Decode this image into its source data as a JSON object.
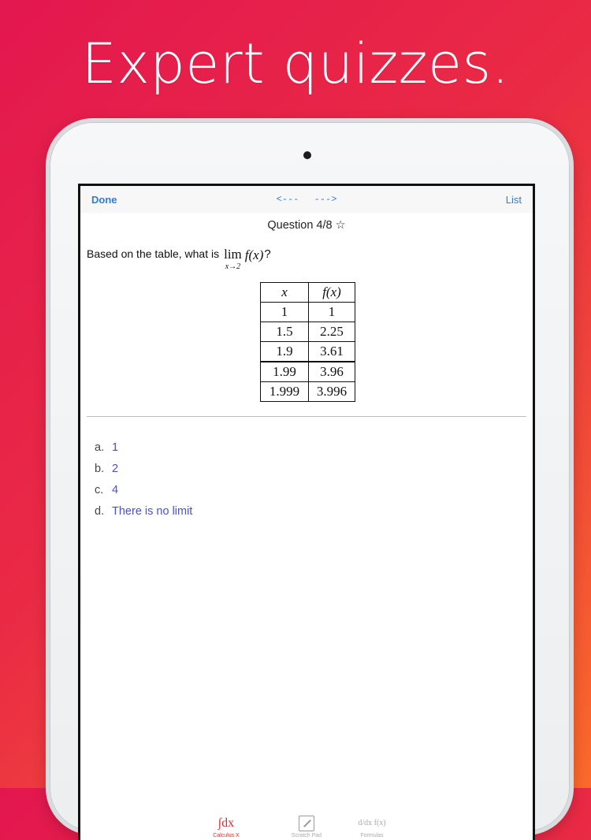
{
  "headline": "Expert quizzes.",
  "navbar": {
    "done_label": "Done",
    "prev_label": "<---",
    "next_label": "--->",
    "list_label": "List"
  },
  "question": {
    "title": "Question 4/8 ☆",
    "text": "Based on the table, what is",
    "lim_word": "lim",
    "lim_sub": "x→2",
    "function": "f(x)",
    "end": "?"
  },
  "table": {
    "headers": [
      "x",
      "f(x)"
    ],
    "rows": [
      [
        "1",
        "1"
      ],
      [
        "1.5",
        "2.25"
      ],
      [
        "1.9",
        "3.61"
      ],
      [
        "1.99",
        "3.96"
      ],
      [
        "1.999",
        "3.996"
      ]
    ]
  },
  "choices": [
    {
      "letter": "a.",
      "text": "1"
    },
    {
      "letter": "b.",
      "text": "2"
    },
    {
      "letter": "c.",
      "text": "4"
    },
    {
      "letter": "d.",
      "text": "There is no limit"
    }
  ],
  "tabbar": {
    "items": [
      {
        "label": "Calculus X",
        "icon": "integral-dx-icon",
        "active": true
      },
      {
        "label": "Scratch Pad",
        "icon": "scratch-pad-icon",
        "active": false
      },
      {
        "label": "Formulas",
        "icon": "derivative-icon",
        "active": false
      }
    ],
    "active_color": "#e02a2a",
    "inactive_color": "#a9a9a9"
  },
  "colors": {
    "link_blue": "#2b7fd9",
    "choice_purple": "#4a4fd8",
    "gradient_start": "#e3174f",
    "gradient_end": "#fb6a2a"
  }
}
